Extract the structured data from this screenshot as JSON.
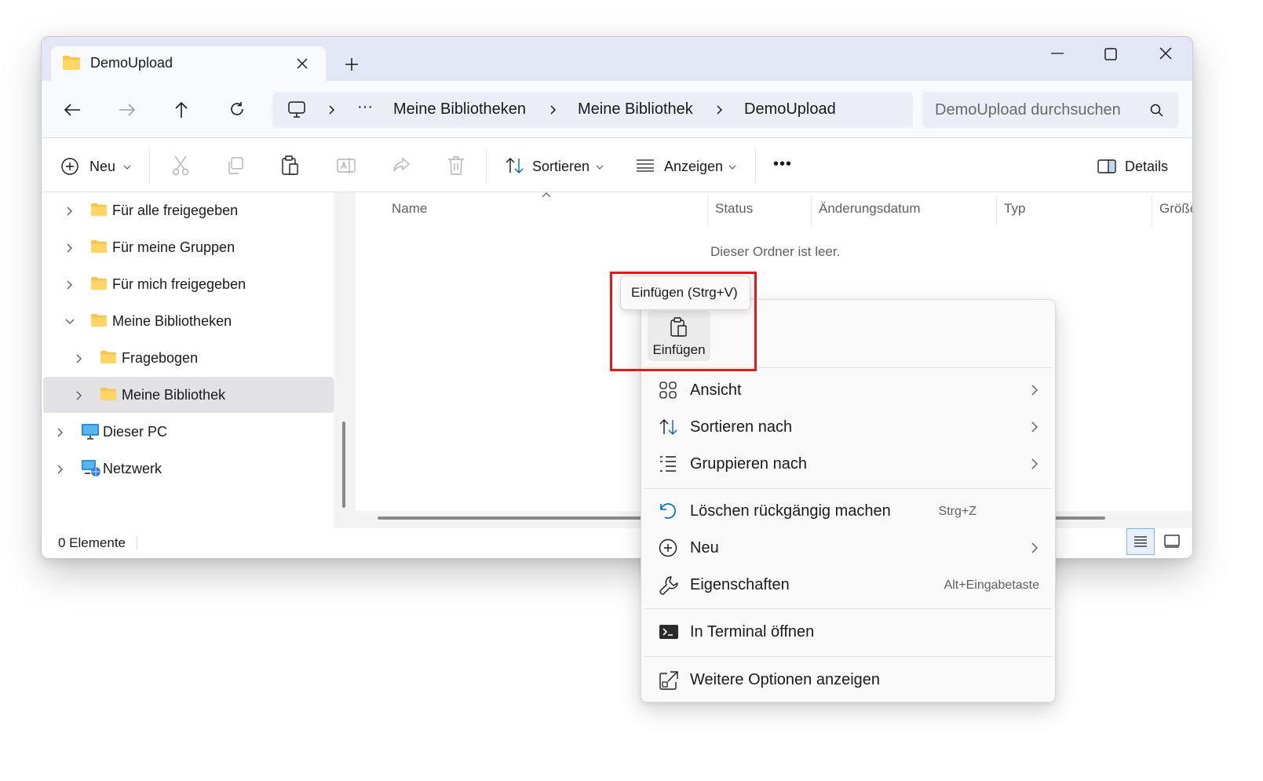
{
  "colors": {
    "accent": "#0067c0",
    "highlight": "#e2191b",
    "folder": "#f7c548"
  },
  "window": {
    "tab_title": "DemoUpload",
    "tab_icon": "folder-icon",
    "new_tab": "+",
    "controls": [
      "minimize-icon",
      "maximize-icon",
      "close-icon"
    ]
  },
  "nav": {
    "breadcrumbs": [
      "Meine Bibliotheken",
      "Meine Bibliothek",
      "DemoUpload"
    ],
    "overflow": "···",
    "search_placeholder": "DemoUpload durchsuchen"
  },
  "toolbar": {
    "new_label": "Neu",
    "sort_label": "Sortieren",
    "view_label": "Anzeigen",
    "more_label": "•••",
    "details_label": "Details"
  },
  "sidebar": {
    "items": [
      {
        "label": "Für alle freigegeben",
        "icon": "folder-icon"
      },
      {
        "label": "Für meine Gruppen",
        "icon": "folder-icon"
      },
      {
        "label": "Für mich freigegeben",
        "icon": "folder-icon"
      },
      {
        "label": "Meine Bibliotheken",
        "icon": "folder-icon",
        "expanded": true
      },
      {
        "label": "Fragebogen",
        "icon": "folder-icon"
      },
      {
        "label": "Meine Bibliothek",
        "icon": "folder-icon",
        "selected": true
      },
      {
        "label": "Dieser PC",
        "icon": "monitor-icon"
      },
      {
        "label": "Netzwerk",
        "icon": "network-icon"
      }
    ]
  },
  "content": {
    "columns": [
      "Name",
      "Status",
      "Änderungsdatum",
      "Typ",
      "Größe"
    ],
    "empty_message": "Dieser Ordner ist leer."
  },
  "status": {
    "count_text": "0 Elemente"
  },
  "context_menu": {
    "paste_label": "Einfügen",
    "tooltip": "Einfügen (Strg+V)",
    "items": [
      {
        "label": "Ansicht",
        "icon": "grid-icon",
        "submenu": true
      },
      {
        "label": "Sortieren nach",
        "icon": "sort-icon",
        "submenu": true
      },
      {
        "label": "Gruppieren nach",
        "icon": "list-icon",
        "submenu": true
      },
      {
        "label": "Löschen rückgängig machen",
        "icon": "undo-icon",
        "shortcut": "Strg+Z"
      },
      {
        "label": "Neu",
        "icon": "plus-circle-icon",
        "submenu": true
      },
      {
        "label": "Eigenschaften",
        "icon": "wrench-icon",
        "shortcut": "Alt+Eingabetaste"
      },
      {
        "label": "In Terminal öffnen",
        "icon": "terminal-icon"
      },
      {
        "label": "Weitere Optionen anzeigen",
        "icon": "share-open-icon"
      }
    ]
  }
}
